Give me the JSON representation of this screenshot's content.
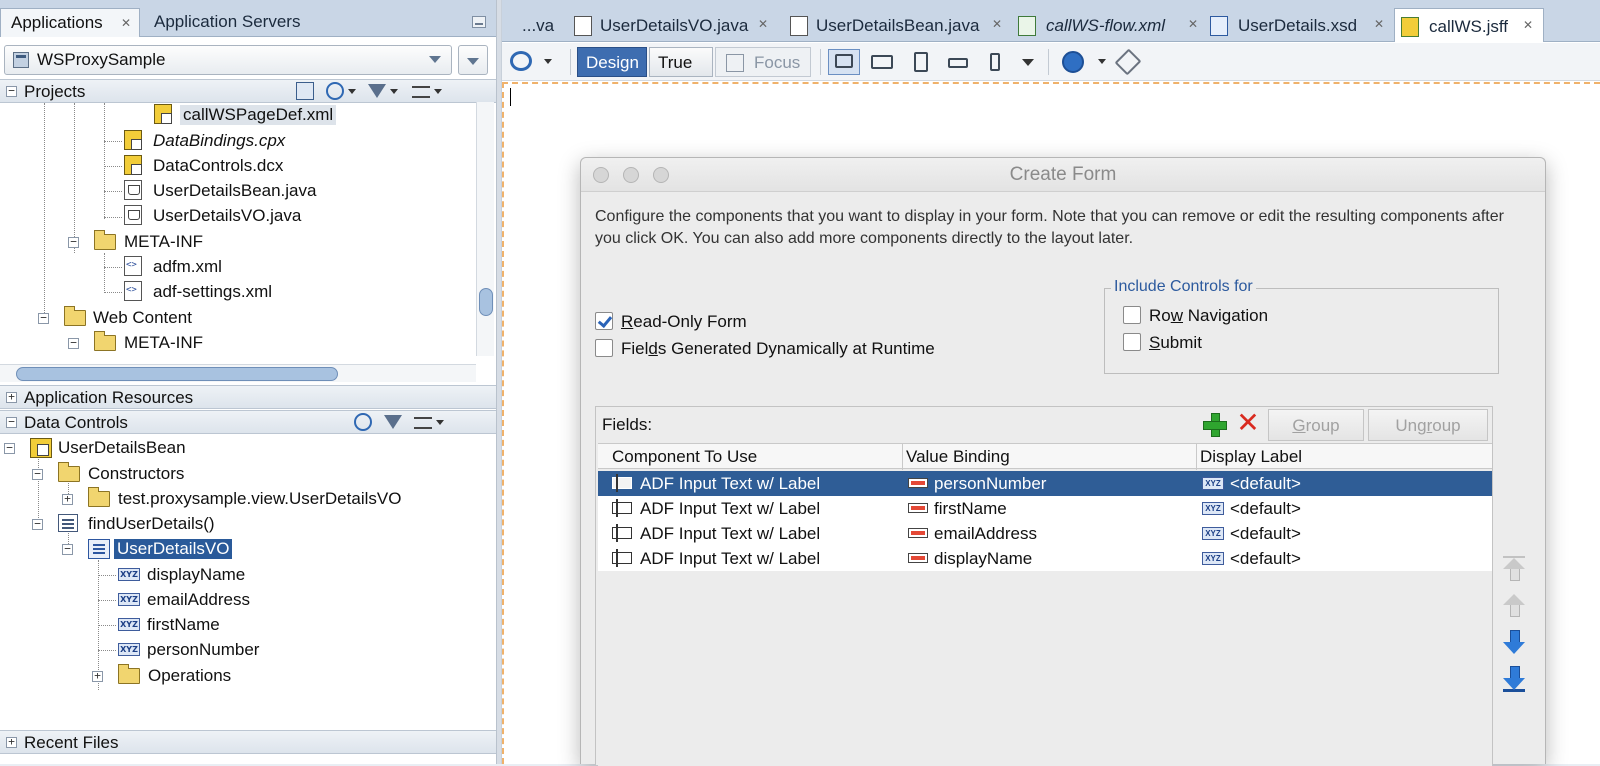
{
  "left_panel": {
    "tabs": [
      {
        "label": "Applications",
        "active": true
      },
      {
        "label": "Application Servers",
        "active": false
      }
    ],
    "app_selector": {
      "value": "WSProxySample"
    },
    "projects_header": {
      "label": "Projects"
    },
    "projects_tree": [
      {
        "label": "callWSPageDef.xml",
        "icon": "pagedef-icon",
        "highlighted": true
      },
      {
        "label": "DataBindings.cpx",
        "icon": "pagedef-icon",
        "italic": true
      },
      {
        "label": "DataControls.dcx",
        "icon": "pagedef-icon"
      },
      {
        "label": "UserDetailsBean.java",
        "icon": "java-file-icon"
      },
      {
        "label": "UserDetailsVO.java",
        "icon": "java-file-icon"
      },
      {
        "label": "META-INF",
        "icon": "folder-icon"
      },
      {
        "label": "adfm.xml",
        "icon": "xml-file-icon"
      },
      {
        "label": "adf-settings.xml",
        "icon": "xml-file-icon"
      },
      {
        "label": "Web Content",
        "icon": "folder-icon"
      },
      {
        "label": "META-INF",
        "icon": "folder-icon"
      }
    ],
    "app_resources_header": {
      "label": "Application Resources"
    },
    "data_controls_header": {
      "label": "Data Controls"
    },
    "data_controls_tree": [
      {
        "label": "UserDetailsBean",
        "icon": "bean-icon"
      },
      {
        "label": "Constructors",
        "icon": "folder-icon"
      },
      {
        "label": "test.proxysample.view.UserDetailsVO",
        "icon": "folder-icon"
      },
      {
        "label": "findUserDetails()",
        "icon": "method-icon"
      },
      {
        "label": "UserDetailsVO",
        "icon": "collection-icon",
        "selected": true
      },
      {
        "label": "displayName",
        "icon": "attribute-icon"
      },
      {
        "label": "emailAddress",
        "icon": "attribute-icon"
      },
      {
        "label": "firstName",
        "icon": "attribute-icon"
      },
      {
        "label": "personNumber",
        "icon": "attribute-icon"
      },
      {
        "label": "Operations",
        "icon": "folder-icon"
      }
    ],
    "recent_files_header": {
      "label": "Recent Files"
    }
  },
  "editor": {
    "tabs": [
      {
        "label": "...va",
        "icon": ""
      },
      {
        "label": "UserDetailsVO.java",
        "icon": "java-file-icon"
      },
      {
        "label": "UserDetailsBean.java",
        "icon": "java-file-icon"
      },
      {
        "label": "callWS-flow.xml",
        "icon": "taskflow-icon",
        "italic": true
      },
      {
        "label": "UserDetails.xsd",
        "icon": "xsd-icon"
      },
      {
        "label": "callWS.jsff",
        "icon": "jsff-icon",
        "active": true
      }
    ],
    "toolbar": {
      "design_label": "Design",
      "true_label": "True",
      "focus_label": "Focus"
    }
  },
  "dialog": {
    "title": "Create Form",
    "description": "Configure the components that you want to display in your form. Note that you can remove or edit the resulting components after you click OK. You can also add more components directly to the layout later.",
    "read_only": {
      "label_u": "R",
      "label_rest": "ead-Only Form",
      "checked": true
    },
    "dynamic": {
      "label_a": "Fiel",
      "label_u": "d",
      "label_b": "s Generated Dynamically at Runtime",
      "checked": false
    },
    "include_controls": {
      "title": "Include Controls for",
      "row_nav": {
        "label_a": "Ro",
        "label_u": "w",
        "label_b": " Navigation",
        "checked": false
      },
      "submit": {
        "label_u": "S",
        "label_b": "ubmit",
        "checked": false
      }
    },
    "fields": {
      "label": "Fields:",
      "group_button": {
        "label_u": "G",
        "label_b": "roup"
      },
      "ungroup_button": {
        "label_a": "Ung",
        "label_u": "r",
        "label_b": "oup"
      },
      "columns": [
        "Component To Use",
        "Value Binding",
        "Display Label"
      ],
      "rows": [
        {
          "component": "ADF Input Text w/ Label",
          "binding": "personNumber",
          "label": "<default>",
          "selected": true
        },
        {
          "component": "ADF Input Text w/ Label",
          "binding": "firstName",
          "label": "<default>"
        },
        {
          "component": "ADF Input Text w/ Label",
          "binding": "emailAddress",
          "label": "<default>"
        },
        {
          "component": "ADF Input Text w/ Label",
          "binding": "displayName",
          "label": "<default>"
        }
      ]
    }
  }
}
